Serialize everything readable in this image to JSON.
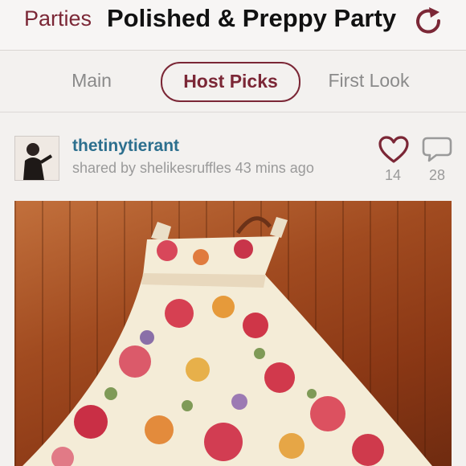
{
  "header": {
    "back_label": "Parties",
    "title": "Polished & Preppy Party",
    "refresh_icon": "refresh-icon"
  },
  "tabs": [
    {
      "label": "Main",
      "active": false
    },
    {
      "label": "Host Picks",
      "active": true
    },
    {
      "label": "First Look",
      "active": false
    }
  ],
  "post": {
    "username": "thetinytierant",
    "shared_text": "shared by shelikesruffles 43 mins ago",
    "likes": "14",
    "comments": "28"
  },
  "colors": {
    "accent": "#7b2736",
    "username": "#2c6f8e",
    "muted": "#9a9a9a"
  }
}
